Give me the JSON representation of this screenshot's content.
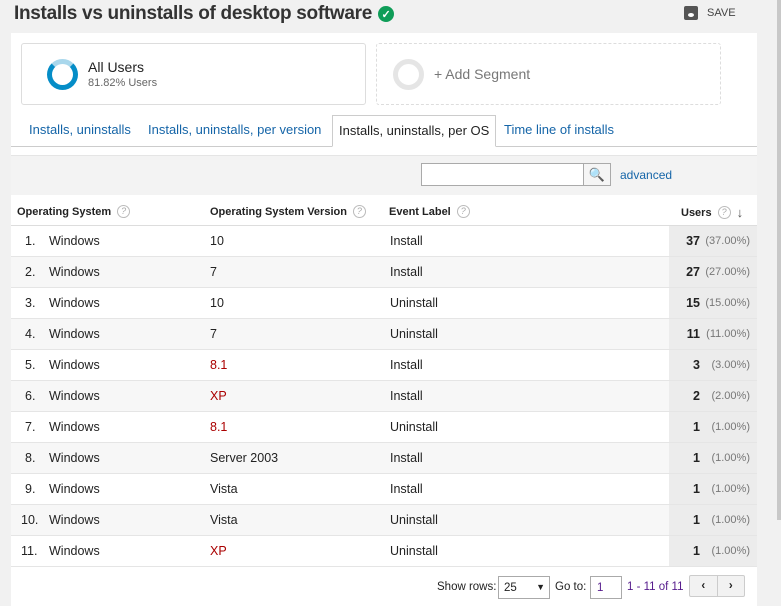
{
  "header": {
    "title": "Installs vs uninstalls of desktop software",
    "save_label": "SAVE"
  },
  "segments": [
    {
      "name": "All Users",
      "detail": "81.82% Users"
    },
    {
      "name": "+ Add Segment"
    }
  ],
  "tabs": [
    {
      "label": "Installs, uninstalls"
    },
    {
      "label": "Installs, uninstalls, per version"
    },
    {
      "label": "Installs, uninstalls, per OS",
      "active": true
    },
    {
      "label": "Time line of installs"
    }
  ],
  "toolbar": {
    "search_value": "",
    "advanced": "advanced"
  },
  "table": {
    "columns": [
      "Operating System",
      "Operating System Version",
      "Event Label",
      "Users"
    ],
    "rows": [
      {
        "n": "1.",
        "os": "Windows",
        "ver": "10",
        "label": "Install",
        "users": "37",
        "pct": "(37.00%)"
      },
      {
        "n": "2.",
        "os": "Windows",
        "ver": "7",
        "label": "Install",
        "users": "27",
        "pct": "(27.00%)"
      },
      {
        "n": "3.",
        "os": "Windows",
        "ver": "10",
        "label": "Uninstall",
        "users": "15",
        "pct": "(15.00%)"
      },
      {
        "n": "4.",
        "os": "Windows",
        "ver": "7",
        "label": "Uninstall",
        "users": "11",
        "pct": "(11.00%)"
      },
      {
        "n": "5.",
        "os": "Windows",
        "ver": "8.1",
        "label": "Install",
        "users": "3",
        "pct": "(3.00%)"
      },
      {
        "n": "6.",
        "os": "Windows",
        "ver": "XP",
        "label": "Install",
        "users": "2",
        "pct": "(2.00%)"
      },
      {
        "n": "7.",
        "os": "Windows",
        "ver": "8.1",
        "label": "Uninstall",
        "users": "1",
        "pct": "(1.00%)"
      },
      {
        "n": "8.",
        "os": "Windows",
        "ver": "Server 2003",
        "label": "Install",
        "users": "1",
        "pct": "(1.00%)"
      },
      {
        "n": "9.",
        "os": "Windows",
        "ver": "Vista",
        "label": "Install",
        "users": "1",
        "pct": "(1.00%)"
      },
      {
        "n": "10.",
        "os": "Windows",
        "ver": "Vista",
        "label": "Uninstall",
        "users": "1",
        "pct": "(1.00%)"
      },
      {
        "n": "11.",
        "os": "Windows",
        "ver": "XP",
        "label": "Uninstall",
        "users": "1",
        "pct": "(1.00%)"
      }
    ]
  },
  "footer": {
    "show_rows_label": "Show rows:",
    "show_rows_value": "25",
    "goto_label": "Go to:",
    "goto_value": "1",
    "range": "1 - 11 of 11",
    "prev": "‹",
    "next": "›"
  }
}
